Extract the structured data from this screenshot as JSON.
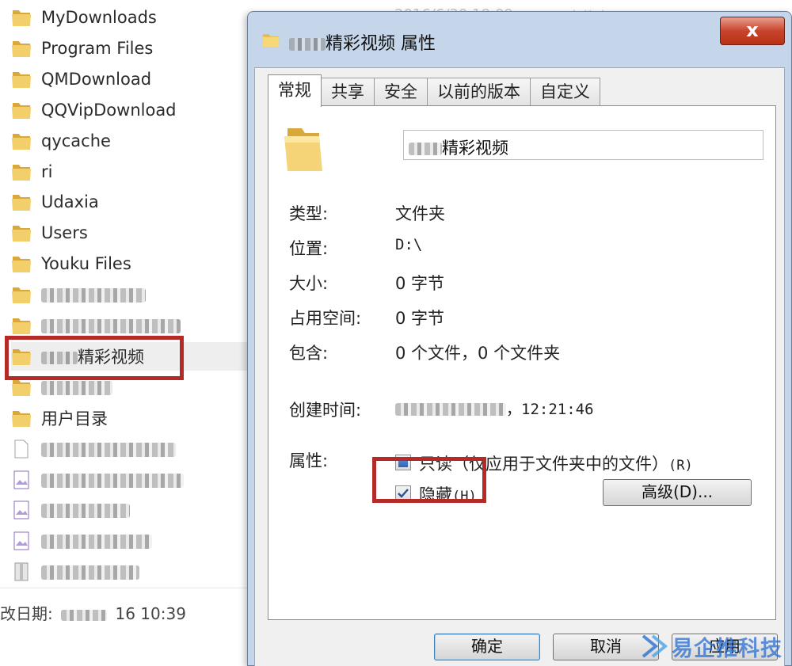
{
  "explorer": {
    "top_ghost_date": "2016/6/30 18:09",
    "top_ghost_type": "文件夹",
    "items": [
      {
        "name": "MyDownloads",
        "icon": "folder-icon"
      },
      {
        "name": "Program Files",
        "icon": "folder-icon"
      },
      {
        "name": "QMDownload",
        "icon": "folder-icon"
      },
      {
        "name": "QQVipDownload",
        "icon": "folder-icon"
      },
      {
        "name": "qycache",
        "icon": "folder-icon"
      },
      {
        "name": "ri",
        "icon": "folder-icon"
      },
      {
        "name": "Udaxia",
        "icon": "folder-icon"
      },
      {
        "name": "Users",
        "icon": "folder-icon"
      },
      {
        "name": "Youku Files",
        "icon": "folder-icon"
      },
      {
        "name": "",
        "icon": "folder-icon"
      },
      {
        "name": "",
        "icon": "folder-icon"
      },
      {
        "name": "精彩视频",
        "icon": "folder-icon"
      },
      {
        "name": "",
        "icon": "folder-icon"
      },
      {
        "name": "用户目录",
        "icon": "folder-icon"
      },
      {
        "name": "",
        "icon": "file-icon"
      },
      {
        "name": "",
        "icon": "image-file-icon"
      },
      {
        "name": "",
        "icon": "image-file-icon"
      },
      {
        "name": "",
        "icon": "image-file-icon"
      },
      {
        "name": "",
        "icon": "archive-file-icon"
      }
    ],
    "status_label": "改日期:",
    "status_value": "16 10:39"
  },
  "dialog": {
    "title": "精彩视频 属性",
    "close_label": "x",
    "tabs": [
      "常规",
      "共享",
      "安全",
      "以前的版本",
      "自定义"
    ],
    "active_tab": "常规",
    "folder_name": "精彩视频",
    "properties": [
      {
        "label": "类型:",
        "value": "文件夹"
      },
      {
        "label": "位置:",
        "value": "D:\\"
      },
      {
        "label": "大小:",
        "value": "0 字节"
      },
      {
        "label": "占用空间:",
        "value": "0 字节"
      },
      {
        "label": "包含:",
        "value": "0 个文件，0 个文件夹"
      }
    ],
    "created_label": "创建时间:",
    "created_value": "，12:21:46",
    "attributes_label": "属性:",
    "readonly_label": "只读（仅应用于文件夹中的文件）",
    "readonly_hotkey": "(R)",
    "readonly_state": "indeterminate",
    "hidden_label": "隐藏",
    "hidden_hotkey": "(H)",
    "hidden_checked": true,
    "advanced_button": "高级(D)...",
    "ok_button": "确定",
    "cancel_button": "取消",
    "apply_button": "应用"
  },
  "watermark": {
    "text": "易企推科技"
  },
  "colors": {
    "highlight_red": "#b52a26",
    "folder_yellow": "#f2cf6b",
    "dialog_frame": "#c5d6ea",
    "watermark_blue": "#2c6fd0"
  }
}
